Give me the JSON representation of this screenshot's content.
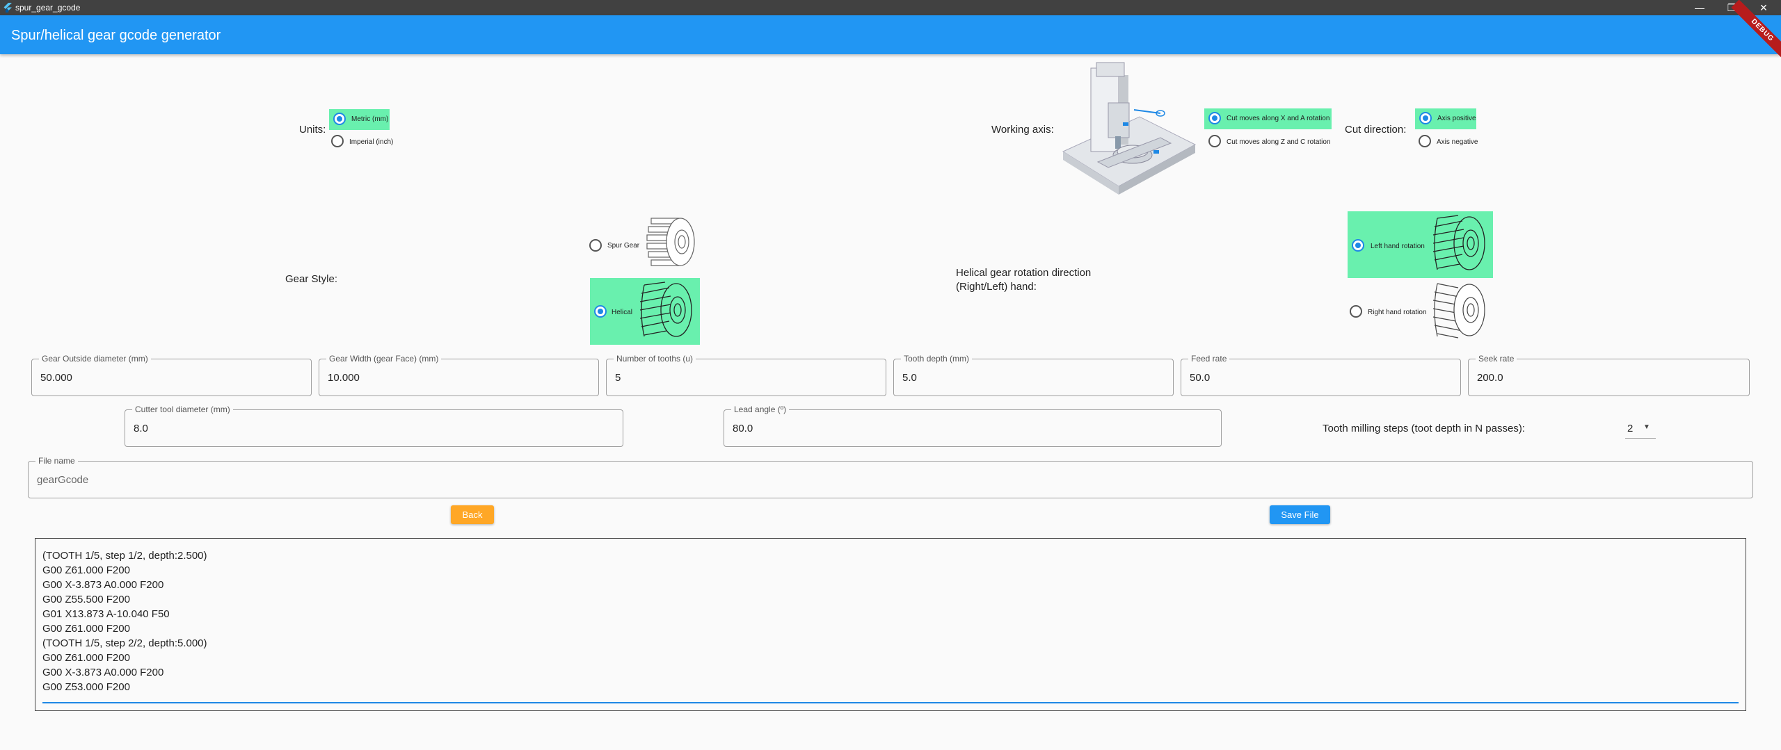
{
  "window": {
    "title": "spur_gear_gcode",
    "minimize": "—",
    "maximize": "❐",
    "close": "✕"
  },
  "appbar": {
    "title": "Spur/helical gear gcode generator",
    "debug": "DEBUG"
  },
  "units": {
    "label": "Units:",
    "options": [
      {
        "label": "Metric (mm)",
        "selected": true
      },
      {
        "label": "Imperial (inch)",
        "selected": false
      }
    ]
  },
  "working_axis": {
    "label": "Working axis:",
    "options": [
      {
        "label": "Cut moves along X and A rotation",
        "selected": true
      },
      {
        "label": "Cut moves along Z and C rotation",
        "selected": false
      }
    ]
  },
  "cut_direction": {
    "label": "Cut direction:",
    "options": [
      {
        "label": "Axis positive",
        "selected": true
      },
      {
        "label": "Axis negative",
        "selected": false
      }
    ]
  },
  "gear_style": {
    "label": "Gear Style:",
    "options": [
      {
        "label": "Spur Gear",
        "selected": false
      },
      {
        "label": "Helical",
        "selected": true
      }
    ]
  },
  "rotation_direction": {
    "label_line1": "Helical gear rotation direction",
    "label_line2": "(Right/Left) hand:",
    "options": [
      {
        "label": "Left hand rotation",
        "selected": true
      },
      {
        "label": "Right hand rotation",
        "selected": false
      }
    ]
  },
  "fields": {
    "outside_diameter": {
      "label": "Gear Outside diameter (mm)",
      "value": "50.000"
    },
    "gear_width": {
      "label": "Gear Width (gear Face) (mm)",
      "value": "10.000"
    },
    "num_tooths": {
      "label": "Number of tooths (u)",
      "value": "5"
    },
    "tooth_depth": {
      "label": "Tooth depth (mm)",
      "value": "5.0"
    },
    "feed_rate": {
      "label": "Feed rate",
      "value": "50.0"
    },
    "seek_rate": {
      "label": "Seek rate",
      "value": "200.0"
    },
    "cutter_diameter": {
      "label": "Cutter tool diameter (mm)",
      "value": "8.0"
    },
    "lead_angle": {
      "label": "Lead angle (º)",
      "value": "80.0"
    },
    "file_name": {
      "label": "File name",
      "placeholder": "gearGcode"
    }
  },
  "milling_steps": {
    "label": "Tooth milling steps (toot depth in N passes):",
    "value": "2"
  },
  "buttons": {
    "back": "Back",
    "save": "Save File"
  },
  "output": {
    "lines": [
      "(TOOTH 1/5, step 1/2, depth:2.500)",
      "G00 Z61.000 F200",
      "G00 X-3.873 A0.000 F200",
      "G00 Z55.500 F200",
      "G01 X13.873 A-10.040 F50",
      "G00 Z61.000 F200",
      "(TOOTH 1/5, step 2/2, depth:5.000)",
      "G00 Z61.000 F200",
      "G00 X-3.873 A0.000 F200",
      "G00 Z53.000 F200"
    ]
  },
  "colors": {
    "appbar": "#2196f3",
    "highlight": "#69f0ae",
    "back_button": "#ffa726",
    "save_button": "#2196f3"
  }
}
